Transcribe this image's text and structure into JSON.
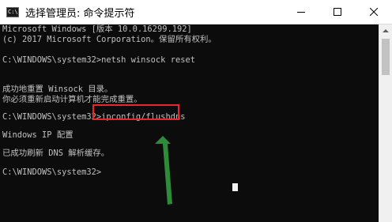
{
  "window": {
    "title": "选择管理员: 命令提示符",
    "icon_label": "C:\\"
  },
  "controls": {
    "minimize": "minimize-icon",
    "maximize": "maximize-icon",
    "close": "close-icon"
  },
  "console_lines": [
    "Microsoft Windows [版本 10.0.16299.192]",
    "(c) 2017 Microsoft Corporation。保留所有权利。",
    "",
    "C:\\WINDOWS\\system32>netsh winsock reset",
    "",
    "成功地重置 Winsock 目录。",
    "你必须重新启动计算机才能完成重置。",
    "",
    "C:\\WINDOWS\\system32>ipconfig/flushdns",
    "",
    "Windows IP 配置",
    "",
    "已成功刷新 DNS 解析缓存。",
    "",
    "C:\\WINDOWS\\system32>"
  ],
  "colors": {
    "console_bg": "#0c0c0c",
    "console_text": "#c0c0c0",
    "highlight_box": "#e8262b",
    "arrow": "#2e8b3a"
  }
}
